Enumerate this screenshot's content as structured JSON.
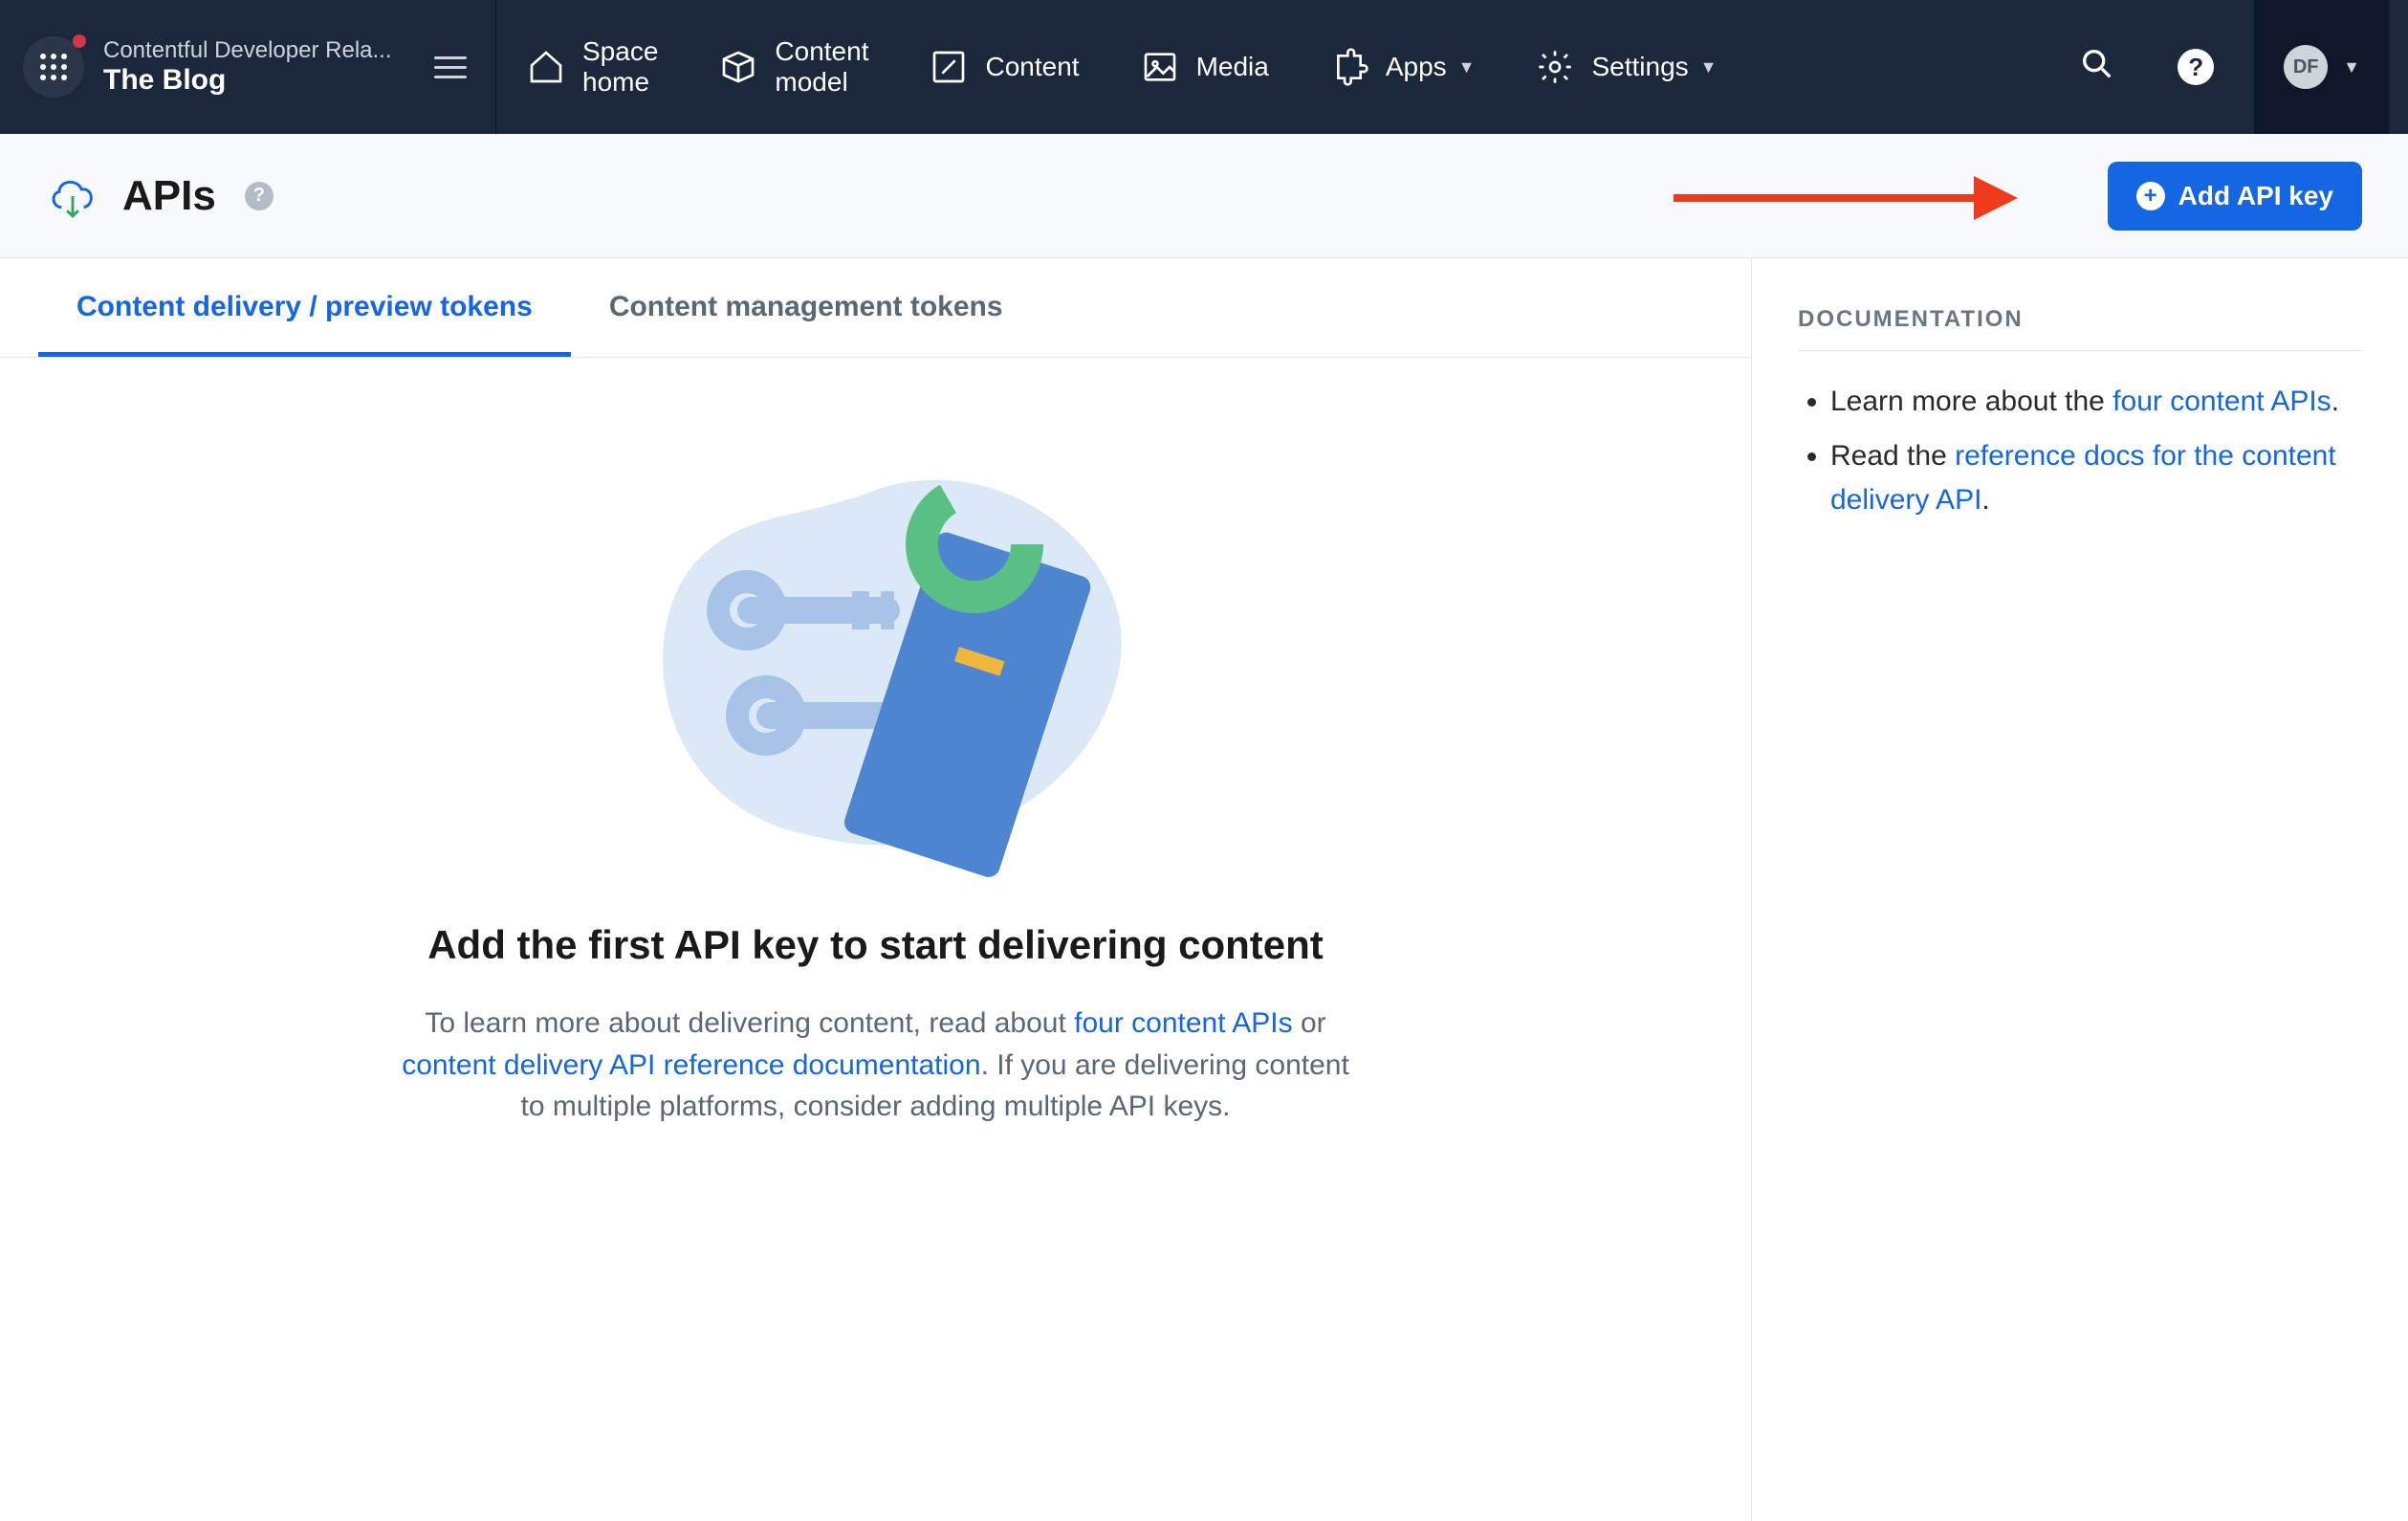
{
  "header": {
    "org_name": "Contentful Developer Rela...",
    "space_name": "The Blog",
    "nav": {
      "space_home_line1": "Space",
      "space_home_line2": "home",
      "content_model_line1": "Content",
      "content_model_line2": "model",
      "content": "Content",
      "media": "Media",
      "apps": "Apps",
      "settings": "Settings"
    },
    "user_initials": "DF"
  },
  "page": {
    "title": "APIs",
    "add_btn": "Add API key"
  },
  "tabs": {
    "delivery": "Content delivery / preview tokens",
    "management": "Content management tokens"
  },
  "empty_state": {
    "heading": "Add the first API key to start delivering content",
    "p1_a": "To learn more about delivering content, read about ",
    "p1_link1": "four content APIs",
    "p1_b": " or ",
    "p1_link2": "content delivery API reference documentation",
    "p1_c": ". If you are delivering content to multiple platforms, consider adding multiple API keys."
  },
  "sidebar": {
    "heading": "DOCUMENTATION",
    "li1_a": "Learn more about the ",
    "li1_link": "four content APIs",
    "li1_b": ".",
    "li2_a": "Read the ",
    "li2_link": "reference docs for the content delivery API",
    "li2_b": "."
  }
}
